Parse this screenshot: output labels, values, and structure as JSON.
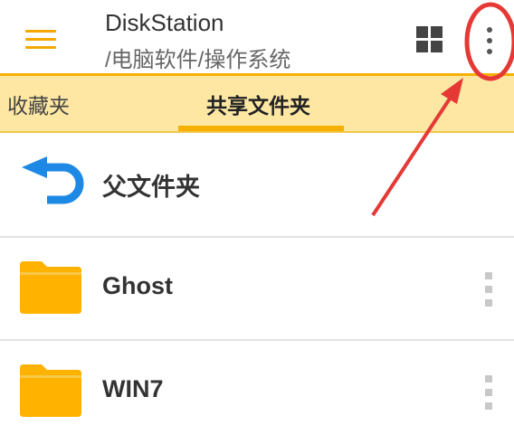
{
  "app": {
    "title": "DiskStation",
    "path": "/电脑软件/操作系统"
  },
  "header": {
    "menu_icon": "menu-icon",
    "view_toggle_icon": "grid-view-icon",
    "more_icon": "more-vertical-icon"
  },
  "tabs": [
    {
      "label": "收藏夹",
      "active": false
    },
    {
      "label": "共享文件夹",
      "active": true
    }
  ],
  "list": {
    "parent": {
      "label": "父文件夹",
      "icon": "back-arrow-icon"
    },
    "items": [
      {
        "label": "Ghost",
        "icon": "folder-icon"
      },
      {
        "label": "WIN7",
        "icon": "folder-icon"
      }
    ]
  },
  "colors": {
    "accent": "#f5b000",
    "tab_background": "#fde7a3",
    "back_arrow": "#1e88e5",
    "annotation": "#e53935"
  }
}
